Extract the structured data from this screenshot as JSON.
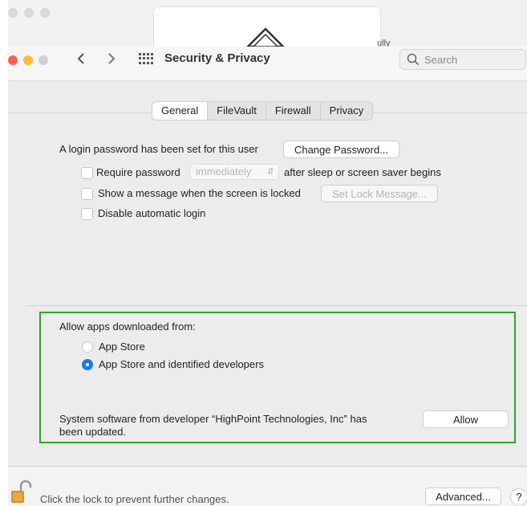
{
  "window": {
    "title": "Security & Privacy",
    "search_placeholder": "Search",
    "background_text": "ully"
  },
  "tabs": [
    {
      "label": "General",
      "active": true
    },
    {
      "label": "FileVault",
      "active": false
    },
    {
      "label": "Firewall",
      "active": false
    },
    {
      "label": "Privacy",
      "active": false
    }
  ],
  "general": {
    "login_text": "A login password has been set for this user",
    "change_password_label": "Change Password...",
    "require_password_label": "Require password",
    "require_password_value": "immediately",
    "after_sleep_text": "after sleep or screen saver begins",
    "show_message_label": "Show a message when the screen is locked",
    "set_lock_message_label": "Set Lock Message...",
    "disable_login_label": "Disable automatic login"
  },
  "allow_apps": {
    "heading": "Allow apps downloaded from:",
    "options": [
      {
        "label": "App Store",
        "selected": false
      },
      {
        "label": "App Store and identified developers",
        "selected": true
      }
    ],
    "system_software_line1": "System software from developer “HighPoint Technologies, Inc” has",
    "system_software_line2": "been updated.",
    "allow_label": "Allow"
  },
  "footer": {
    "lock_text": "Click the lock to prevent further changes.",
    "advanced_label": "Advanced...",
    "help_label": "?"
  },
  "colors": {
    "highlight_border": "#2ea82a",
    "accent": "#1a7bf3",
    "close": "#fe5f57",
    "minimize": "#febc2e"
  }
}
